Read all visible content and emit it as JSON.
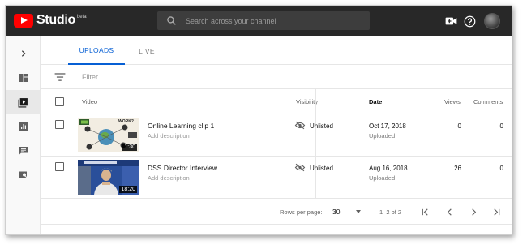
{
  "header": {
    "logo_text": "Studio",
    "logo_badge": "beta",
    "search_placeholder": "Search across your channel"
  },
  "sidebar": {
    "items": [
      {
        "icon": "chevron-right-icon"
      },
      {
        "icon": "dashboard-icon"
      },
      {
        "icon": "videos-icon",
        "active": true
      },
      {
        "icon": "analytics-icon"
      },
      {
        "icon": "comments-icon"
      },
      {
        "icon": "transcriptions-icon"
      }
    ]
  },
  "tabs": [
    {
      "label": "UPLOADS",
      "active": true
    },
    {
      "label": "LIVE",
      "active": false
    }
  ],
  "filter": {
    "placeholder": "Filter"
  },
  "table": {
    "columns": {
      "video": "Video",
      "visibility": "Visibility",
      "date": "Date",
      "views": "Views",
      "comments": "Comments"
    },
    "rows": [
      {
        "title": "Online Learning clip 1",
        "description": "Add description",
        "duration": "1:30",
        "visibility": "Unlisted",
        "date": "Oct 17, 2018",
        "date_status": "Uploaded",
        "views": "0",
        "comments": "0"
      },
      {
        "title": "DSS Director Interview",
        "description": "Add description",
        "duration": "18:20",
        "visibility": "Unlisted",
        "date": "Aug 16, 2018",
        "date_status": "Uploaded",
        "views": "26",
        "comments": "0"
      }
    ]
  },
  "pagination": {
    "rows_per_page_label": "Rows per page:",
    "rows_per_page_value": "30",
    "range": "1–2 of 2"
  },
  "colors": {
    "header_bg": "#282828",
    "accent": "#065fd4",
    "youtube_red": "#ff0000"
  }
}
